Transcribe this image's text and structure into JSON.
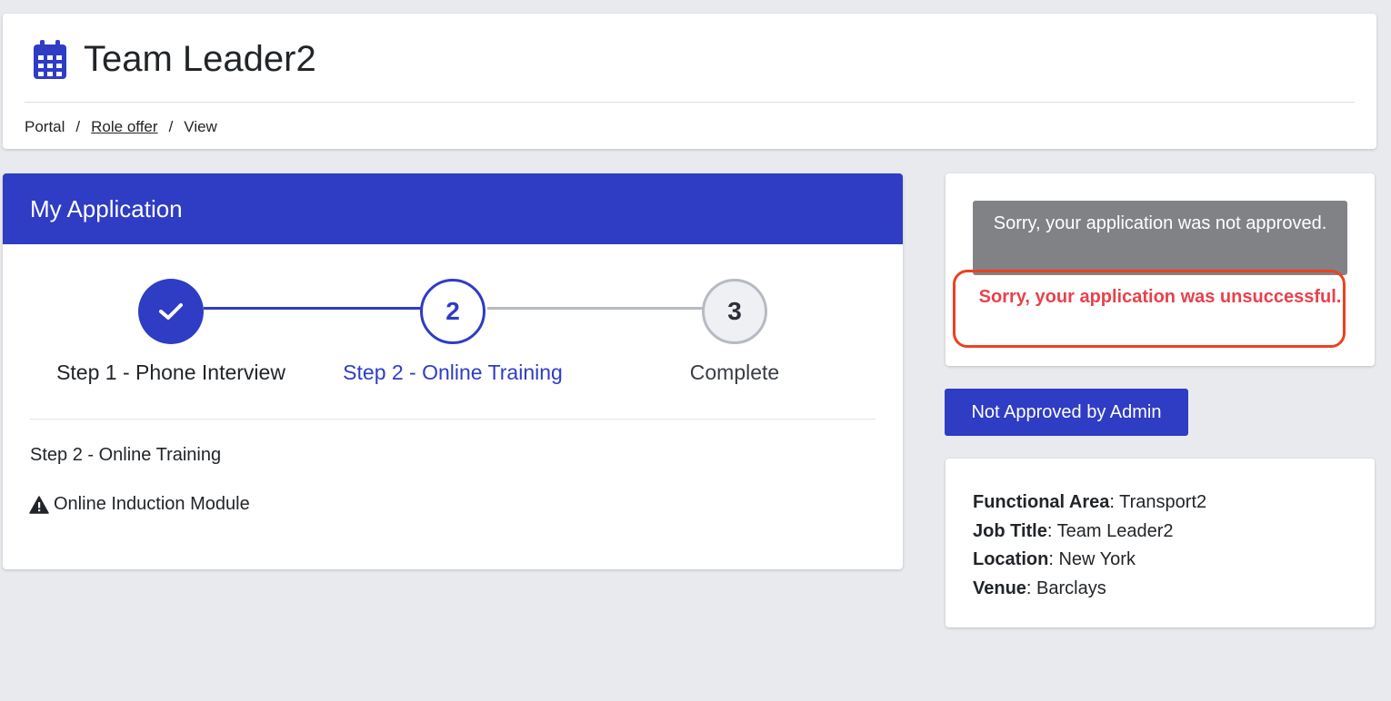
{
  "header": {
    "title": "Team Leader2",
    "icon": "calendar-icon",
    "breadcrumb": {
      "items": [
        "Portal",
        "Role offer",
        "View"
      ],
      "separator": "/"
    }
  },
  "application": {
    "title": "My Application",
    "steps": [
      {
        "number": "1",
        "label": "Step 1 - Phone Interview",
        "state": "completed"
      },
      {
        "number": "2",
        "label": "Step 2 - Online Training",
        "state": "current"
      },
      {
        "number": "3",
        "label": "Complete",
        "state": "pending"
      }
    ],
    "current_step_label": "Step 2 - Online Training",
    "module_label": "Online Induction Module"
  },
  "status": {
    "gray_message": "Sorry, your application was not approved.",
    "red_message": "Sorry, your application was unsuccessful."
  },
  "admin_button_label": "Not Approved by Admin",
  "details": [
    {
      "label": "Functional Area",
      "value": "Transport2"
    },
    {
      "label": "Job Title",
      "value": "Team Leader2"
    },
    {
      "label": "Location",
      "value": "New York"
    },
    {
      "label": "Venue",
      "value": "Barclays"
    }
  ],
  "colors": {
    "primary": "#2f3cc4",
    "gray": "#808286",
    "error_text": "#e9414a",
    "highlight_border": "#ec4121",
    "background": "#e9eaee"
  }
}
